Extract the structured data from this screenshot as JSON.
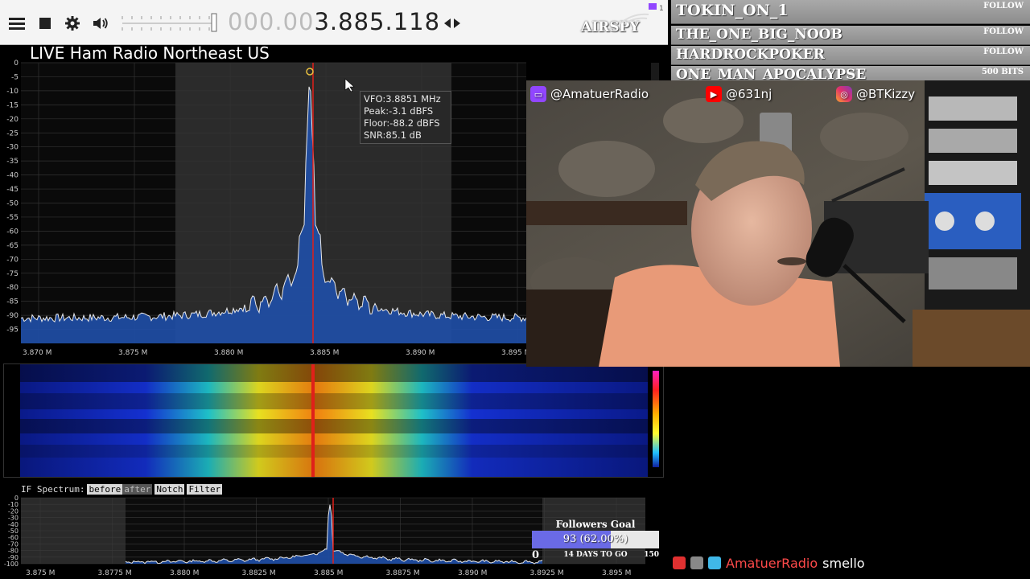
{
  "toolbar": {
    "menu_icon": "hamburger-icon",
    "stop_icon": "stop-icon",
    "settings_icon": "gear-icon",
    "volume_icon": "speaker-icon",
    "frequency_dim": "000.00",
    "frequency_bright": "3.885.118",
    "tune_icon": "left-right-arrows-icon",
    "logo": "AIRSPY"
  },
  "spectrum": {
    "title": "LIVE Ham Radio Northeast US",
    "y_ticks": [
      "0",
      "-5",
      "-10",
      "-15",
      "-20",
      "-25",
      "-30",
      "-35",
      "-40",
      "-45",
      "-50",
      "-55",
      "-60",
      "-65",
      "-70",
      "-75",
      "-80",
      "-85",
      "-90",
      "-95"
    ],
    "x_ticks": [
      "3.870 M",
      "3.875 M",
      "3.880 M",
      "3.885 M",
      "3.890 M",
      "3.895 M"
    ],
    "tooltip": {
      "vfo": "VFO:3.8851 MHz",
      "peak": "Peak:-3.1 dBFS",
      "floor": "Floor:-88.2 dBFS",
      "snr": "SNR:85.1 dB"
    }
  },
  "if_spectrum": {
    "label": "IF Spectrum:",
    "buttons": [
      "before",
      "after",
      "Notch",
      "Filter"
    ],
    "y_ticks": [
      "0",
      "-10",
      "-20",
      "-30",
      "-40",
      "-50",
      "-60",
      "-70",
      "-80",
      "-90",
      "-100"
    ],
    "x_ticks": [
      "3.875 M",
      "3.8775 M",
      "3.880 M",
      "3.8825 M",
      "3.885 M",
      "3.8875 M",
      "3.890 M",
      "3.8925 M",
      "3.895 M"
    ]
  },
  "followers": [
    {
      "name": "TOKIN_ON_1",
      "tag": "FOLLOW"
    },
    {
      "name": "THE_ONE_BIG_NOOB",
      "tag": "FOLLOW"
    },
    {
      "name": "HARDROCKPOKER",
      "tag": "FOLLOW"
    },
    {
      "name": "ONE_MAN_APOCALYPSE",
      "tag": "500 BITS"
    }
  ],
  "socials": {
    "twitch": "@AmatuerRadio",
    "youtube": "@631nj",
    "instagram": "@BTKizzy"
  },
  "goal": {
    "title": "Followers Goal",
    "progress_text": "93 (62.00%)",
    "progress_fraction": 0.62,
    "days": "14 DAYS TO GO",
    "start": "0",
    "target": "150"
  },
  "chat": {
    "user": "AmatuerRadio",
    "message": "smello"
  },
  "colors": {
    "spectrum_fill": "#1f4fa8",
    "vfo_line": "#e0201a",
    "twitch": "#9146ff",
    "youtube": "#ff0000",
    "goal_bar": "#6a6ae6"
  }
}
